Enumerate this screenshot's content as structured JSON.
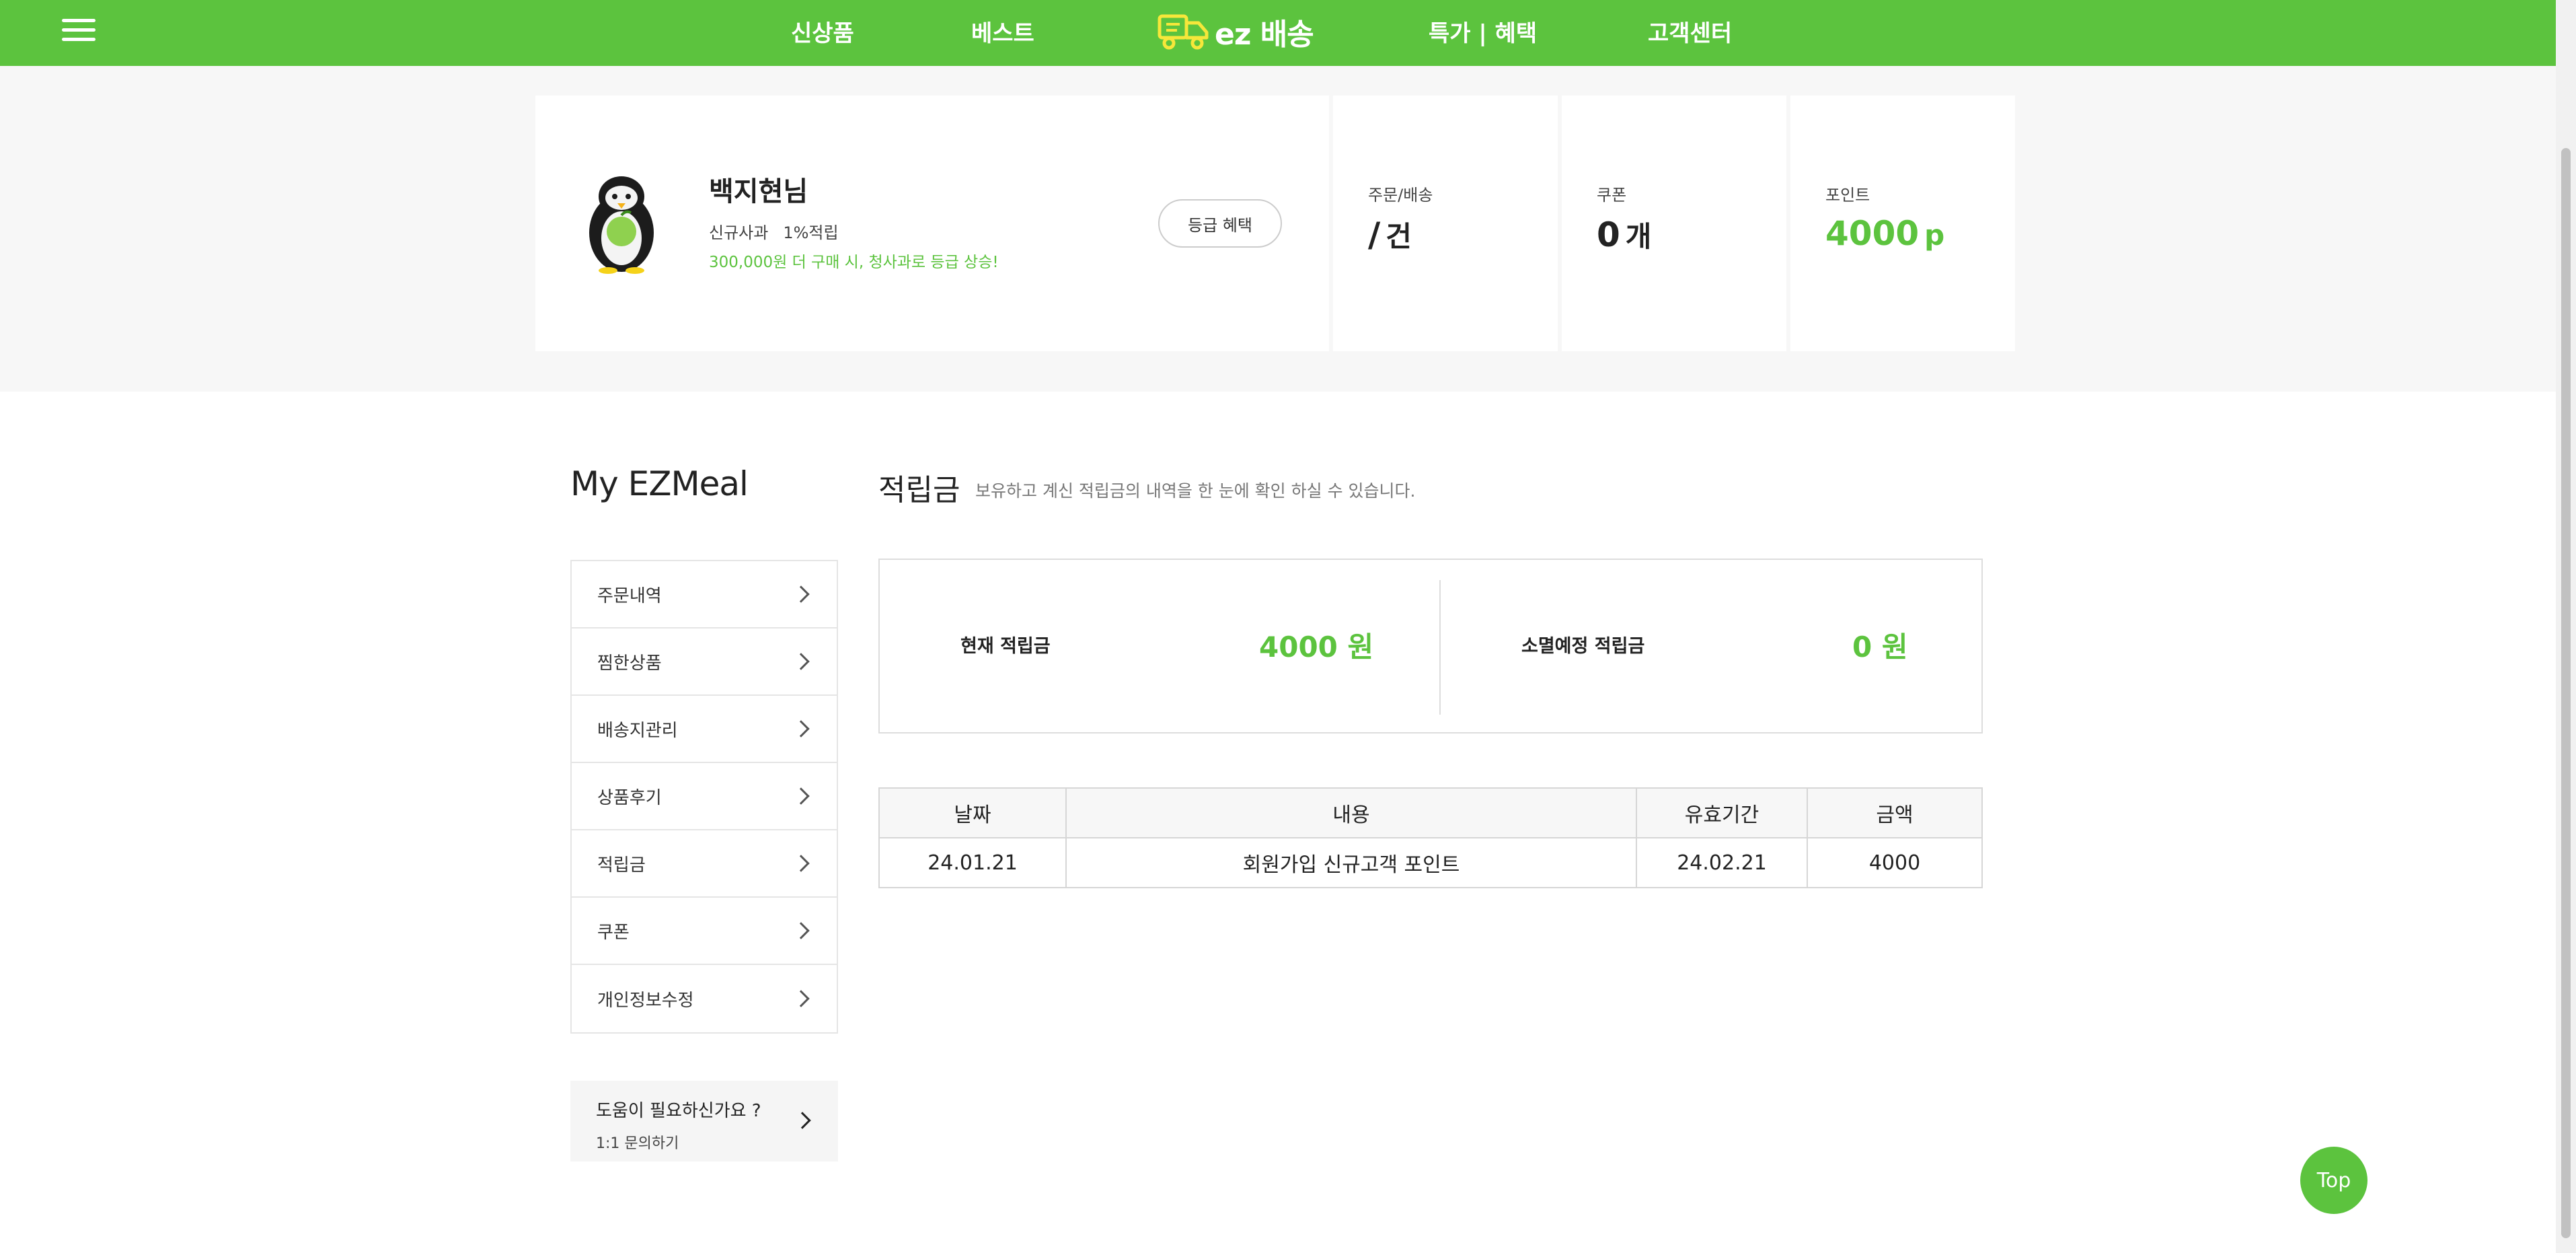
{
  "nav": {
    "links": [
      "신상품",
      "베스트",
      "특가 | 혜택",
      "고객센터"
    ],
    "logo_text": "ez 배송",
    "brand_color": "#5cc33e"
  },
  "profile": {
    "name": "백지현님",
    "grade": "신규사과",
    "rate": "1%적립",
    "note": "300,000원 더 구매 시, 청사과로 등급 상승!",
    "grade_button": "등급 혜택"
  },
  "stats": {
    "orders": {
      "label": "주문/배송",
      "value": "/",
      "unit": "건"
    },
    "coupons": {
      "label": "쿠폰",
      "value": "0",
      "unit": "개"
    },
    "points": {
      "label": "포인트",
      "value": "4000",
      "unit": "p"
    }
  },
  "sidebar": {
    "title": "My EZMeal",
    "items": [
      "주문내역",
      "찜한상품",
      "배송지관리",
      "상품후기",
      "적립금",
      "쿠폰",
      "개인정보수정"
    ],
    "help_title": "도움이 필요하신가요 ?",
    "help_sub": "1:1 문의하기"
  },
  "main": {
    "title": "적립금",
    "description": "보유하고 계신 적립금의 내역을 한 눈에 확인 하실 수 있습니다.",
    "current_label": "현재 적립금",
    "current_value": "4000 원",
    "expiring_label": "소멸예정 적립금",
    "expiring_value": "0 원"
  },
  "history": {
    "headers": [
      "날짜",
      "내용",
      "유효기간",
      "금액"
    ],
    "rows": [
      [
        "24.01.21",
        "회원가입 신규고객 포인트",
        "24.02.21",
        "4000"
      ]
    ]
  },
  "top_button": "Top"
}
